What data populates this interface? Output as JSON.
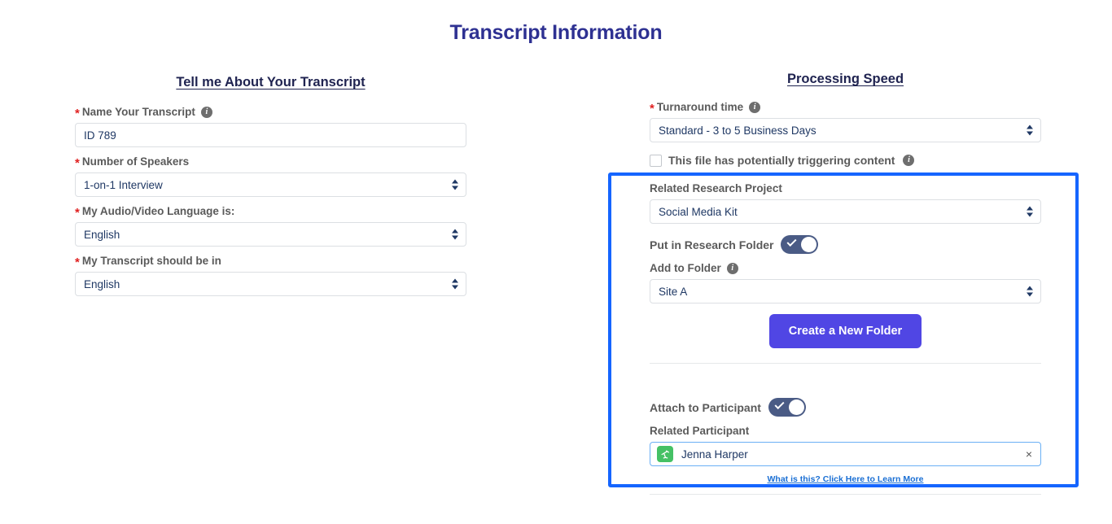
{
  "page": {
    "title": "Transcript Information",
    "title_color": "#2e3192"
  },
  "left_column": {
    "section_title": "Tell me About Your Transcript",
    "fields": [
      {
        "label": "Name Your Transcript",
        "required": true,
        "has_info": true,
        "type": "text",
        "value": "ID 789"
      },
      {
        "label": "Number of Speakers",
        "required": true,
        "has_info": false,
        "type": "select",
        "value": "1-on-1 Interview"
      },
      {
        "label": "My Audio/Video Language is:",
        "required": true,
        "has_info": false,
        "type": "select",
        "value": "English"
      },
      {
        "label": "My Transcript should be in",
        "required": true,
        "has_info": false,
        "type": "select",
        "value": "English"
      }
    ]
  },
  "right_column": {
    "section_title": "Processing Speed",
    "turnaround": {
      "label": "Turnaround time",
      "required": true,
      "has_info": true,
      "value": "Standard - 3 to 5 Business Days"
    },
    "triggering_checkbox": {
      "label": "This file has potentially triggering content",
      "checked": false,
      "has_info": true
    }
  },
  "highlighted_panel": {
    "border_color": "#1565ff",
    "research_project": {
      "label": "Related Research Project",
      "value": "Social Media Kit"
    },
    "put_in_research_folder": {
      "label": "Put in Research Folder",
      "enabled": true
    },
    "add_to_folder": {
      "label": "Add to Folder",
      "has_info": true,
      "value": "Site A"
    },
    "create_folder_button": {
      "label": "Create a New Folder",
      "color": "#5046e4"
    },
    "attach_to_participant": {
      "label": "Attach to Participant",
      "enabled": true
    },
    "related_participant": {
      "label": "Related Participant",
      "value": "Jenna Harper",
      "avatar_color": "#45c165"
    },
    "learn_more_link": "What is this? Click Here to Learn More"
  },
  "icons": {
    "info": "i",
    "clear": "×"
  }
}
